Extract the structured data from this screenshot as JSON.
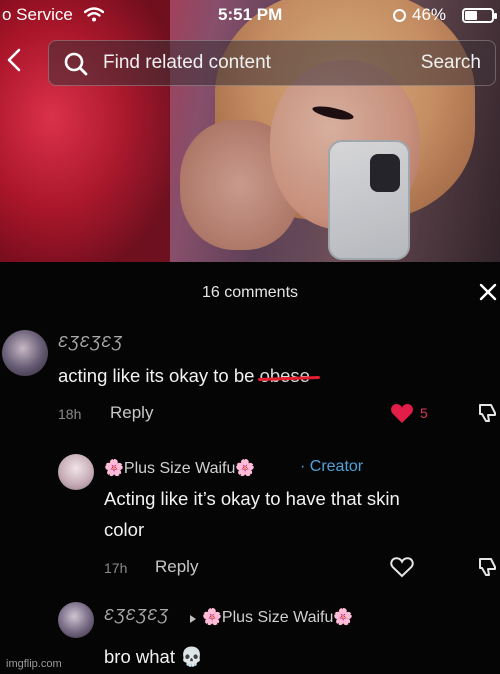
{
  "status_bar": {
    "carrier": "o Service",
    "time": "5:51 PM",
    "battery_text": "46%",
    "battery_level": 0.46
  },
  "search": {
    "placeholder": "Find related content",
    "button": "Search"
  },
  "comments_panel": {
    "title": "16 comments",
    "comments": [
      {
        "username": "ƐƷƐƷƐƷ",
        "text": "acting like its okay to be ",
        "struck_word": "obese",
        "age": "18h",
        "reply_label": "Reply",
        "likes": "5",
        "liked": true
      },
      {
        "username": "🌸Plus Size Waifu🌸",
        "badge": "· Creator",
        "text_line1": "Acting like it’s okay to have that skin",
        "text_line2": "color",
        "age": "17h",
        "reply_label": "Reply"
      },
      {
        "username": "ƐƷƐƷƐƷ",
        "reply_to": "🌸Plus Size Waifu🌸",
        "text": "bro what 💀"
      }
    ]
  },
  "watermark": "imgflip.com",
  "colors": {
    "accent_like": "#e11d48",
    "creator_badge": "#4fa3d9",
    "panel_bg": "#050505"
  }
}
